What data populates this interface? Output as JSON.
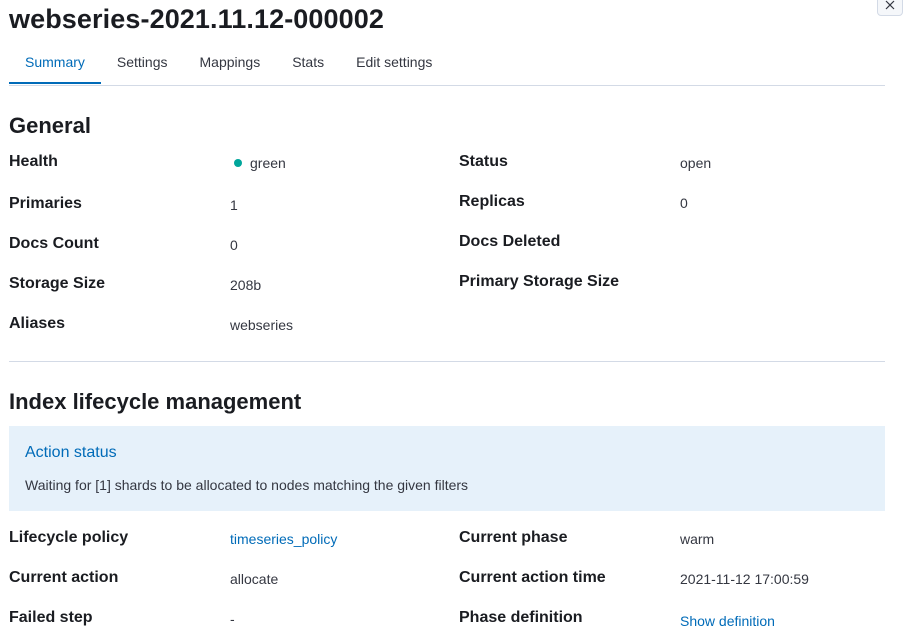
{
  "header": {
    "title": "webseries-2021.11.12-000002"
  },
  "tabs": [
    {
      "label": "Summary",
      "active": true
    },
    {
      "label": "Settings"
    },
    {
      "label": "Mappings"
    },
    {
      "label": "Stats"
    },
    {
      "label": "Edit settings"
    }
  ],
  "general": {
    "title": "General",
    "health": {
      "label": "Health",
      "value": "green",
      "color": "#00a69b"
    },
    "status": {
      "label": "Status",
      "value": "open"
    },
    "primaries": {
      "label": "Primaries",
      "value": "1"
    },
    "replicas": {
      "label": "Replicas",
      "value": "0"
    },
    "docs_count": {
      "label": "Docs Count",
      "value": "0"
    },
    "docs_deleted": {
      "label": "Docs Deleted",
      "value": ""
    },
    "storage_size": {
      "label": "Storage Size",
      "value": "208b"
    },
    "primary_storage_size": {
      "label": "Primary Storage Size",
      "value": ""
    },
    "aliases": {
      "label": "Aliases",
      "value": "webseries"
    }
  },
  "ilm": {
    "title": "Index lifecycle management",
    "action_status": {
      "title": "Action status",
      "message": "Waiting for [1] shards to be allocated to nodes matching the given filters"
    },
    "lifecycle_policy": {
      "label": "Lifecycle policy",
      "value": "timeseries_policy"
    },
    "current_phase": {
      "label": "Current phase",
      "value": "warm"
    },
    "current_action": {
      "label": "Current action",
      "value": "allocate"
    },
    "current_action_time": {
      "label": "Current action time",
      "value": "2021-11-12 17:00:59"
    },
    "failed_step": {
      "label": "Failed step",
      "value": "-"
    },
    "phase_definition": {
      "label": "Phase definition",
      "value": "Show definition"
    }
  },
  "icons": {
    "close": "close-icon",
    "health": "status-dot-icon"
  },
  "colors": {
    "accent": "#006bb8",
    "health_green": "#00a69b",
    "callout_bg": "#e6f1fa"
  }
}
